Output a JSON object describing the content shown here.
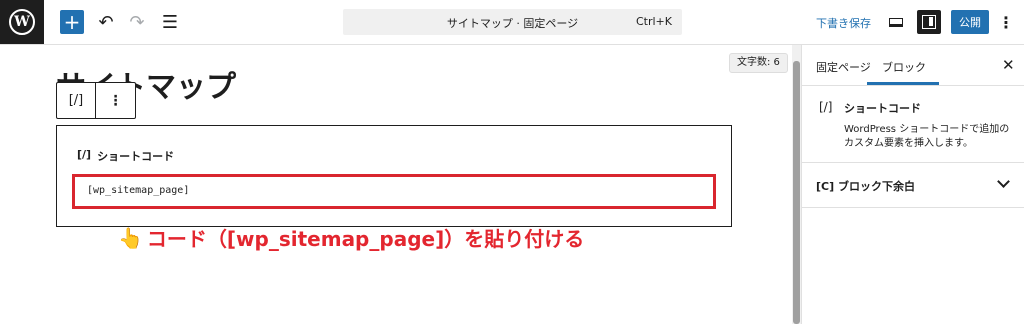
{
  "toolbar": {
    "logo_glyph": "W",
    "add_glyph": "+",
    "undo_glyph": "↶",
    "redo_glyph": "↷",
    "list_view_glyph": "☰",
    "command_title": "サイトマップ · 固定ページ",
    "command_shortcut": "Ctrl+K",
    "save_draft_label": "下書き保存",
    "publish_label": "公開",
    "more_glyph": "⋮"
  },
  "editor": {
    "page_title": "サイトマップ",
    "word_count": "文字数: 6",
    "block_toolbar": {
      "type_glyph": "[/]",
      "more_glyph": "⋮"
    },
    "shortcode_block": {
      "icon_glyph": "[/]",
      "label": "ショートコード",
      "value": "[wp_sitemap_page]"
    },
    "annotation": {
      "hand_glyph": "👆",
      "text": "コード（[wp_sitemap_page]）を貼り付ける"
    }
  },
  "sidebar": {
    "tabs": [
      "固定ページ",
      "ブロック"
    ],
    "active_tab": "ブロック",
    "close_glyph": "✕",
    "block_icon_glyph": "[/]",
    "block_name": "ショートコード",
    "block_description": "WordPress ショートコードで追加のカスタム要素を挿入します。",
    "panel_title": "[C] ブロック下余白"
  },
  "colors": {
    "accent": "#2271b1",
    "annotation": "#e3262f",
    "highlight_border": "#d9262e",
    "logo_bg": "#1e1e1e"
  }
}
